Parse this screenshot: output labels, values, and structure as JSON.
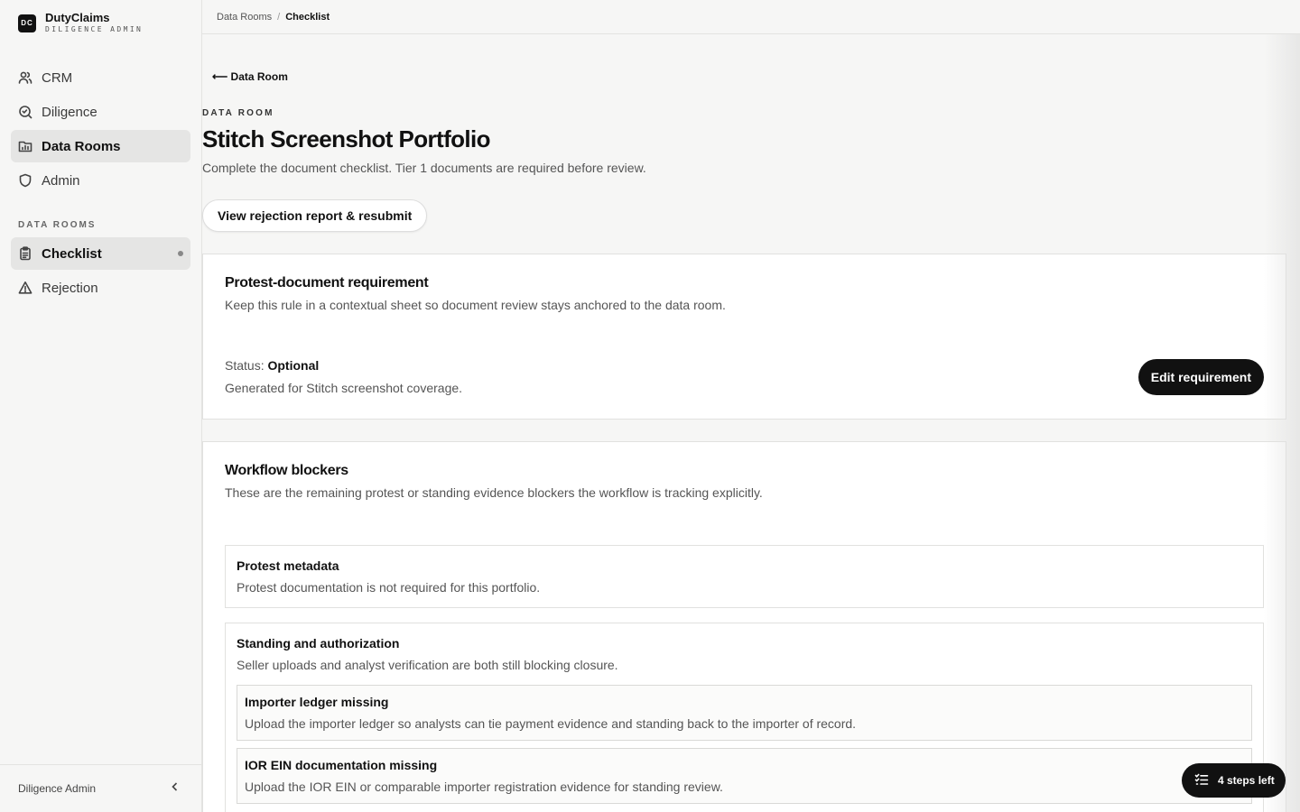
{
  "brand": {
    "logo": "DC",
    "name": "DutyClaims",
    "subtitle": "DILIGENCE ADMIN"
  },
  "nav": [
    {
      "label": "CRM",
      "icon": "users-icon",
      "active": false
    },
    {
      "label": "Diligence",
      "icon": "search-doc-icon",
      "active": false
    },
    {
      "label": "Data Rooms",
      "icon": "folder-chart-icon",
      "active": true
    },
    {
      "label": "Admin",
      "icon": "shield-icon",
      "active": false
    }
  ],
  "section": {
    "label": "DATA ROOMS",
    "items": [
      {
        "label": "Checklist",
        "icon": "clipboard-icon",
        "active": true
      },
      {
        "label": "Rejection",
        "icon": "warning-icon",
        "active": false
      }
    ]
  },
  "footer": {
    "label": "Diligence Admin"
  },
  "breadcrumb": {
    "parent": "Data Rooms",
    "separator": "/",
    "current": "Checklist"
  },
  "main": {
    "back_label": "⟵ Data Room",
    "eyebrow": "DATA ROOM",
    "title": "Stitch Screenshot Portfolio",
    "subtitle": "Complete the document checklist. Tier 1 documents are required before review.",
    "rejection_button": "View rejection report & resubmit"
  },
  "requirement": {
    "title": "Protest-document requirement",
    "description": "Keep this rule in a contextual sheet so document review stays anchored to the data room.",
    "status_label": "Status:",
    "status_value": "Optional",
    "note": "Generated for Stitch screenshot coverage.",
    "edit_button": "Edit requirement"
  },
  "blockers": {
    "title": "Workflow blockers",
    "description": "These are the remaining protest or standing evidence blockers the workflow is tracking explicitly.",
    "items": [
      {
        "title": "Protest metadata",
        "description": "Protest documentation is not required for this portfolio."
      },
      {
        "title": "Standing and authorization",
        "description": "Seller uploads and analyst verification are both still blocking closure.",
        "sub_items": [
          {
            "title": "Importer ledger missing",
            "description": "Upload the importer ledger so analysts can tie payment evidence and standing back to the importer of record."
          },
          {
            "title": "IOR EIN documentation missing",
            "description": "Upload the IOR EIN or comparable importer registration evidence for standing review."
          }
        ]
      }
    ]
  },
  "steps_pill": {
    "label": "4 steps left",
    "icon": "checklist-icon"
  }
}
